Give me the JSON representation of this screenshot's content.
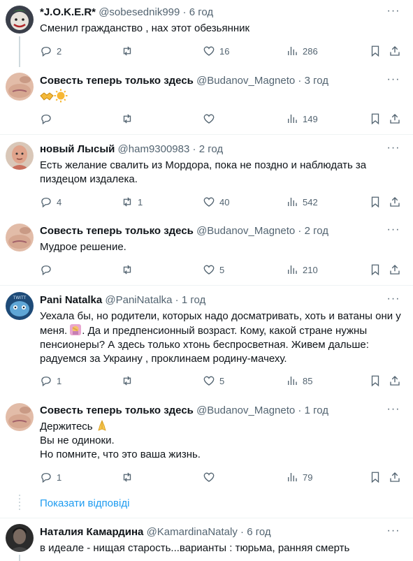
{
  "tweets": [
    {
      "name": "*J.O.K.E.R*",
      "handle": "@sobesednik999",
      "time": "6 год",
      "lines": [
        "Сменил гражданство , нах этот обезьянник"
      ],
      "replies": "2",
      "retweets": "",
      "likes": "16",
      "views": "286"
    },
    {
      "name": "Совесть теперь только здесь",
      "handle": "@Budanov_Magneto",
      "time": "3 год",
      "lines": [
        ""
      ],
      "replies": "",
      "retweets": "",
      "likes": "",
      "views": "149"
    },
    {
      "name": "новый Лысый",
      "handle": "@ham9300983",
      "time": "2 год",
      "lines": [
        "Есть желание свалить из Мордора, пока не поздно и наблюдать за",
        "пиздецом издалека."
      ],
      "replies": "4",
      "retweets": "1",
      "likes": "40",
      "views": "542"
    },
    {
      "name": "Совесть теперь только здесь",
      "handle": "@Budanov_Magneto",
      "time": "2 год",
      "lines": [
        "Мудрое решение."
      ],
      "replies": "",
      "retweets": "",
      "likes": "5",
      "views": "210"
    },
    {
      "name": "Pani Natalka",
      "handle": "@PaniNatalka",
      "time": "1 год",
      "lines": [
        "Уехала бы, но родители, которых надо досматривать, хоть и ватаны они у",
        "меня.",
        "пенсионеры? А здесь только хтонь беспросветная. Живем дальше:",
        "радуемся за Украину , проклинаем родину-мачеху."
      ],
      "line2_rest": ". Да и предпенсионный возраст. Кому, какой стране нужны",
      "replies": "1",
      "retweets": "",
      "likes": "5",
      "views": "85"
    },
    {
      "name": "Совесть теперь только здесь",
      "handle": "@Budanov_Magneto",
      "time": "1 год",
      "lines": [
        "Держитесь",
        "Вы не одиноки.",
        "Но помните, что это ваша жизнь."
      ],
      "replies": "1",
      "retweets": "",
      "likes": "",
      "views": "79"
    },
    {
      "name": "Наталия Камардина",
      "handle": "@KamardinaNataly",
      "time": "6 год",
      "lines": [
        "в идеале - нищая старость...варианты : тюрьма, ранняя смерть"
      ]
    }
  ],
  "show_replies_label": "Показати відповіді",
  "separator": "·",
  "colors": {
    "accent": "#1d9bf0",
    "secondary": "#536471",
    "line": "#cfd9de"
  },
  "icons": [
    "reply-icon",
    "retweet-icon",
    "like-icon",
    "views-icon",
    "bookmark-icon",
    "share-icon",
    "more-icon"
  ]
}
